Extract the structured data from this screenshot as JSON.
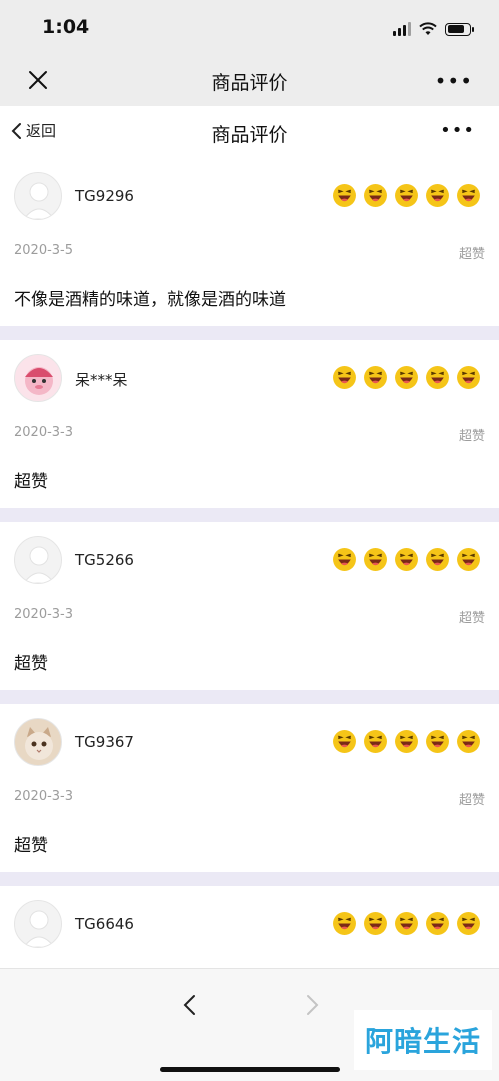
{
  "status": {
    "time": "1:04"
  },
  "wechat": {
    "title": "商品评价"
  },
  "header": {
    "back_label": "返回",
    "title": "商品评价"
  },
  "reviews": [
    {
      "username": "TG9296",
      "date": "2020-3-5",
      "tag": "超赞",
      "comment": "不像是酒精的味道，就像是酒的味道",
      "rating": 5,
      "avatar": "default-avatar"
    },
    {
      "username": "呆***呆",
      "date": "2020-3-3",
      "tag": "超赞",
      "comment": "超赞",
      "rating": 5,
      "avatar": "pink-cartoon-avatar"
    },
    {
      "username": "TG5266",
      "date": "2020-3-3",
      "tag": "超赞",
      "comment": "超赞",
      "rating": 5,
      "avatar": "default-avatar"
    },
    {
      "username": "TG9367",
      "date": "2020-3-3",
      "tag": "超赞",
      "comment": "超赞",
      "rating": 5,
      "avatar": "cat-avatar"
    },
    {
      "username": "TG6646",
      "rating": 5,
      "avatar": "default-avatar"
    }
  ],
  "watermark": "阿暗生活",
  "colors": {
    "emoji": "#f5c518",
    "divider": "#ebe9f5",
    "meta_text": "#9c9c9c"
  }
}
